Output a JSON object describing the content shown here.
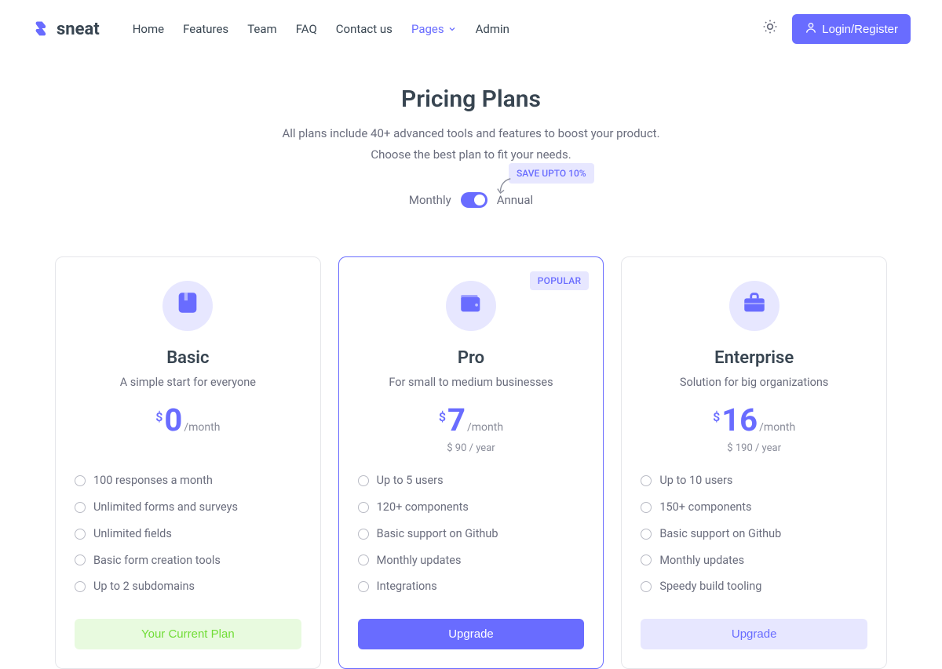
{
  "brand": {
    "name": "sneat"
  },
  "nav": {
    "links": [
      {
        "label": "Home",
        "active": false
      },
      {
        "label": "Features",
        "active": false
      },
      {
        "label": "Team",
        "active": false
      },
      {
        "label": "FAQ",
        "active": false
      },
      {
        "label": "Contact us",
        "active": false
      },
      {
        "label": "Pages",
        "active": true,
        "dropdown": true
      },
      {
        "label": "Admin",
        "active": false
      }
    ],
    "login_label": "Login/Register"
  },
  "hero": {
    "title": "Pricing Plans",
    "subtitle1": "All plans include 40+ advanced tools and features to boost your product.",
    "subtitle2": "Choose the best plan to fit your needs.",
    "toggle": {
      "left": "Monthly",
      "right": "Annual",
      "state": "annual"
    },
    "save_badge": "SAVE UPTO 10%"
  },
  "plans": [
    {
      "name": "Basic",
      "desc": "A simple start for everyone",
      "icon": "book",
      "currency": "$",
      "amount": "0",
      "period": "/month",
      "yearly": "",
      "popular": false,
      "highlight": false,
      "features": [
        "100 responses a month",
        "Unlimited forms and surveys",
        "Unlimited fields",
        "Basic form creation tools",
        "Up to 2 subdomains"
      ],
      "cta": {
        "label": "Your Current Plan",
        "style": "current"
      }
    },
    {
      "name": "Pro",
      "desc": "For small to medium businesses",
      "icon": "wallet",
      "currency": "$",
      "amount": "7",
      "period": "/month",
      "yearly": "$ 90 / year",
      "popular": true,
      "popular_label": "POPULAR",
      "highlight": true,
      "features": [
        "Up to 5 users",
        "120+ components",
        "Basic support on Github",
        "Monthly updates",
        "Integrations"
      ],
      "cta": {
        "label": "Upgrade",
        "style": "primary"
      }
    },
    {
      "name": "Enterprise",
      "desc": "Solution for big organizations",
      "icon": "briefcase",
      "currency": "$",
      "amount": "16",
      "period": "/month",
      "yearly": "$ 190 / year",
      "popular": false,
      "highlight": false,
      "features": [
        "Up to 10 users",
        "150+ components",
        "Basic support on Github",
        "Monthly updates",
        "Speedy build tooling"
      ],
      "cta": {
        "label": "Upgrade",
        "style": "outline"
      }
    }
  ]
}
